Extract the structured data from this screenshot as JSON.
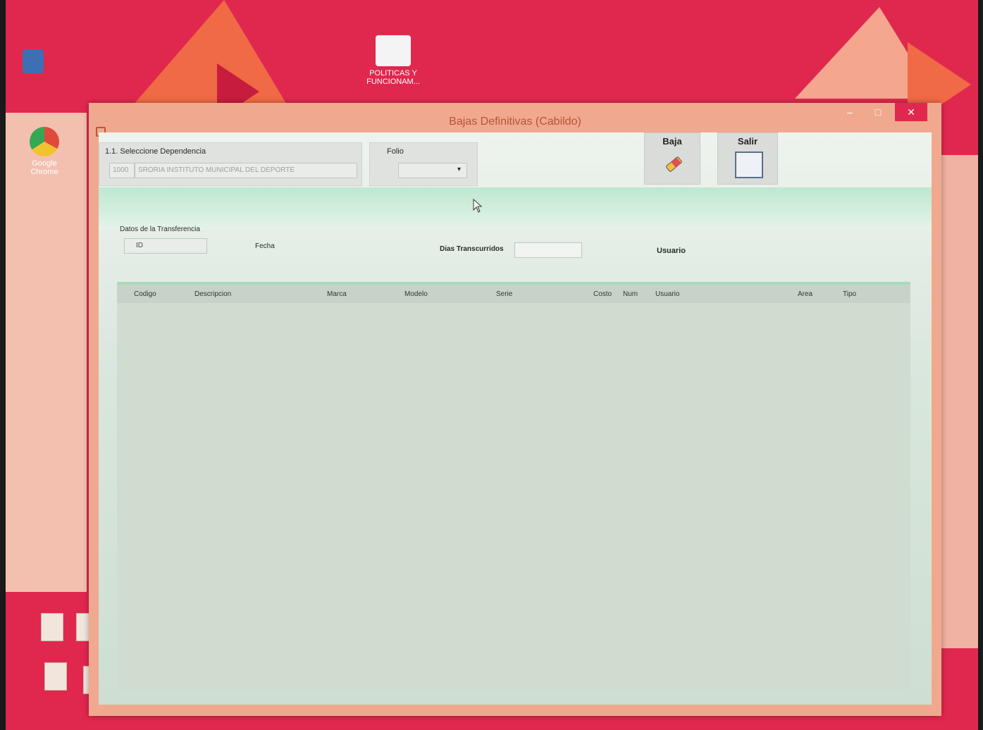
{
  "desktop": {
    "icons": [
      {
        "label": "POLITICAS Y FUNCIONAM..."
      },
      {
        "label": "Google Chrome"
      }
    ]
  },
  "window": {
    "title": "Bajas Definitivas (Cabildo)",
    "controls": {
      "minimize": "–",
      "maximize": "□",
      "close": "✕"
    }
  },
  "form": {
    "dependency_label": "1.1. Seleccione Dependencia",
    "dependency_code": "1000",
    "dependency_name": "SRORIA INSTITUTO MUNICIPAL DEL DEPORTE",
    "folio_label": "Folio",
    "folio_value": "",
    "baja_label": "Baja",
    "salir_label": "Salir",
    "section_label": "Datos de la Transferencia",
    "id_value": "ID",
    "fecha_label": "Fecha",
    "dias_label": "Dias Transcurridos",
    "dias_value": "",
    "usuario_label": "Usuario"
  },
  "grid": {
    "columns": [
      "Codigo",
      "Descripcion",
      "Marca",
      "Modelo",
      "Serie",
      "Costo",
      "Num",
      "Usuario",
      "Area",
      "Tipo"
    ]
  },
  "colors": {
    "desktop_bg": "#e0284f",
    "window_frame": "#f0a98e",
    "accent_green": "#a6dcb8",
    "close_button": "#e0284f"
  }
}
